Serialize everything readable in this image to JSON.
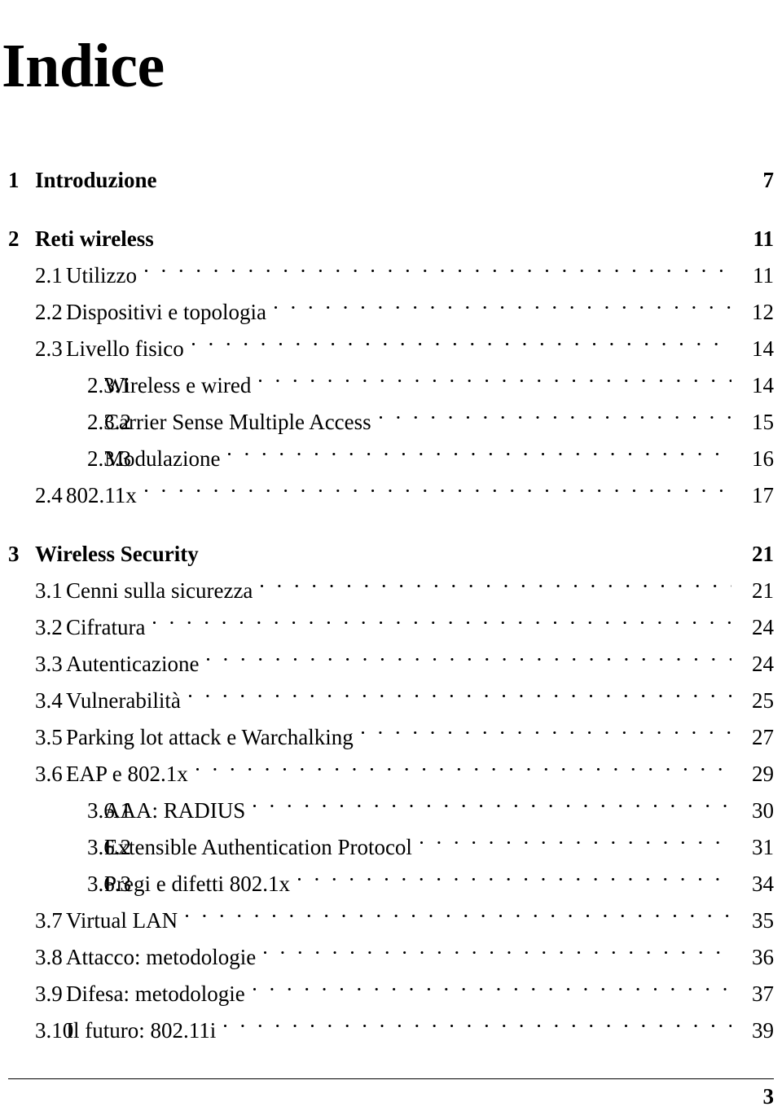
{
  "document": {
    "title": "Indice",
    "footer_page_number": "3"
  },
  "toc": {
    "entries": [
      {
        "level": 0,
        "number": "1",
        "label": "Introduzione",
        "page": "7"
      },
      {
        "level": 0,
        "number": "2",
        "label": "Reti wireless",
        "page": "11"
      },
      {
        "level": 1,
        "number": "2.1",
        "label": "Utilizzo",
        "page": "11"
      },
      {
        "level": 1,
        "number": "2.2",
        "label": "Dispositivi e topologia",
        "page": "12"
      },
      {
        "level": 1,
        "number": "2.3",
        "label": "Livello fisico",
        "page": "14"
      },
      {
        "level": 2,
        "number": "2.3.1",
        "label": "Wireless e wired",
        "page": "14"
      },
      {
        "level": 2,
        "number": "2.3.2",
        "label": "Carrier Sense Multiple Access",
        "page": "15"
      },
      {
        "level": 2,
        "number": "2.3.3",
        "label": "Modulazione",
        "page": "16"
      },
      {
        "level": 1,
        "number": "2.4",
        "label": "802.11x",
        "page": "17"
      },
      {
        "level": 0,
        "number": "3",
        "label": "Wireless Security",
        "page": "21"
      },
      {
        "level": 1,
        "number": "3.1",
        "label": "Cenni sulla sicurezza",
        "page": "21"
      },
      {
        "level": 1,
        "number": "3.2",
        "label": "Cifratura",
        "page": "24"
      },
      {
        "level": 1,
        "number": "3.3",
        "label": "Autenticazione",
        "page": "24"
      },
      {
        "level": 1,
        "number": "3.4",
        "label": "Vulnerabilità",
        "page": "25"
      },
      {
        "level": 1,
        "number": "3.5",
        "label": "Parking lot attack e Warchalking",
        "page": "27"
      },
      {
        "level": 1,
        "number": "3.6",
        "label": "EAP e 802.1x",
        "page": "29"
      },
      {
        "level": 2,
        "number": "3.6.1",
        "label": "AAA: RADIUS",
        "page": "30"
      },
      {
        "level": 2,
        "number": "3.6.2",
        "label": "Extensible Authentication Protocol",
        "page": "31"
      },
      {
        "level": 2,
        "number": "3.6.3",
        "label": "Pregi e difetti 802.1x",
        "page": "34"
      },
      {
        "level": 1,
        "number": "3.7",
        "label": "Virtual LAN",
        "page": "35"
      },
      {
        "level": 1,
        "number": "3.8",
        "label": "Attacco: metodologie",
        "page": "36"
      },
      {
        "level": 1,
        "number": "3.9",
        "label": "Difesa: metodologie",
        "page": "37"
      },
      {
        "level": 1,
        "number": "3.10",
        "label": "Il futuro: 802.11i",
        "page": "39"
      }
    ]
  }
}
